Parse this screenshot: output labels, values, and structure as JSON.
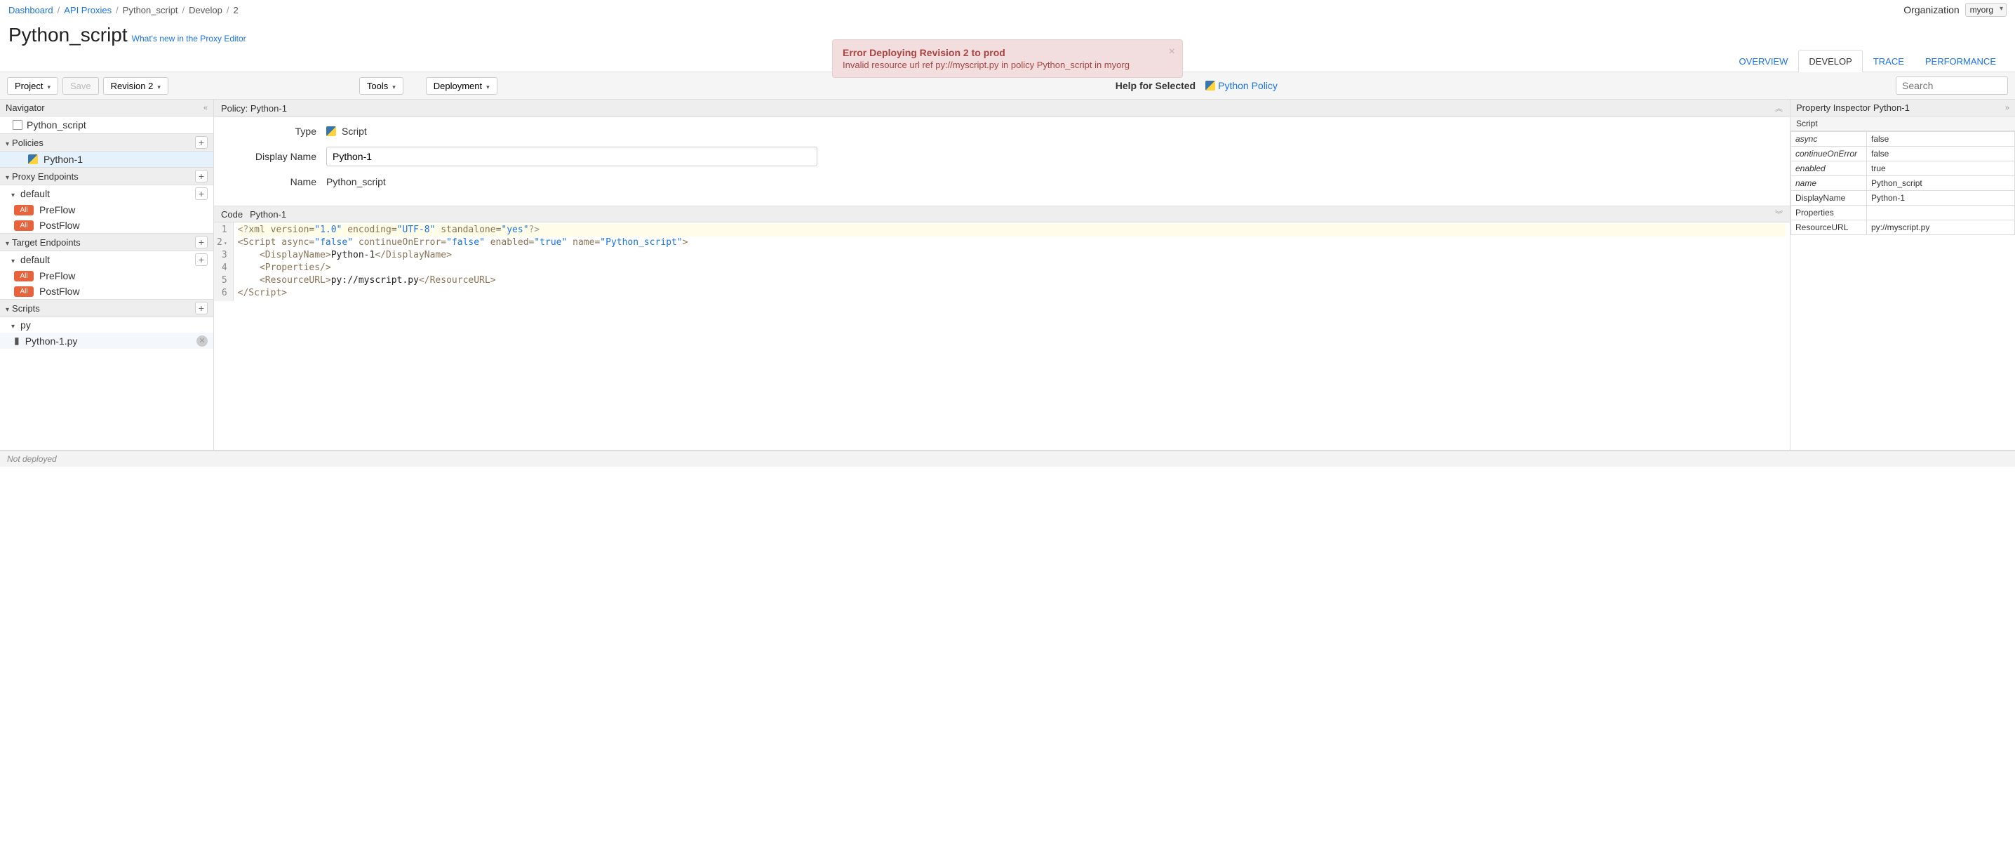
{
  "breadcrumb": {
    "dashboard": "Dashboard",
    "proxies": "API Proxies",
    "name": "Python_script",
    "develop": "Develop",
    "rev": "2"
  },
  "organization": {
    "label": "Organization",
    "value": "myorg"
  },
  "title": "Python_script",
  "whatsnew": "What's new in the Proxy Editor",
  "alert": {
    "title": "Error Deploying Revision 2 to prod",
    "message": "Invalid resource url ref py://myscript.py in policy Python_script in myorg"
  },
  "tabs": {
    "overview": "OVERVIEW",
    "develop": "DEVELOP",
    "trace": "TRACE",
    "performance": "PERFORMANCE"
  },
  "toolbar": {
    "project": "Project",
    "save": "Save",
    "revision": "Revision 2",
    "tools": "Tools",
    "deployment": "Deployment",
    "help_label": "Help for Selected",
    "help_link": "Python Policy",
    "search_placeholder": "Search"
  },
  "navigator": {
    "title": "Navigator",
    "root": "Python_script",
    "policies": "Policies",
    "policy1": "Python-1",
    "proxy_endpoints": "Proxy Endpoints",
    "default": "default",
    "preflow": "PreFlow",
    "postflow": "PostFlow",
    "target_endpoints": "Target Endpoints",
    "scripts": "Scripts",
    "py": "py",
    "script_file": "Python-1.py",
    "all": "All"
  },
  "policy": {
    "header": "Policy: Python-1",
    "type_label": "Type",
    "type_value": "Script",
    "display_name_label": "Display Name",
    "display_name_value": "Python-1",
    "name_label": "Name",
    "name_value": "Python_script"
  },
  "code": {
    "label": "Code",
    "name": "Python-1",
    "lines": [
      "1",
      "2",
      "3",
      "4",
      "5",
      "6"
    ]
  },
  "inspector": {
    "header": "Property Inspector  Python-1",
    "section": "Script",
    "rows": [
      {
        "k": "async",
        "v": "false",
        "ital": true
      },
      {
        "k": "continueOnError",
        "v": "false",
        "ital": true
      },
      {
        "k": "enabled",
        "v": "true",
        "ital": true
      },
      {
        "k": "name",
        "v": "Python_script",
        "ital": true
      },
      {
        "k": "DisplayName",
        "v": "Python-1",
        "ital": false
      },
      {
        "k": "Properties",
        "v": "",
        "ital": false
      },
      {
        "k": "ResourceURL",
        "v": "py://myscript.py",
        "ital": false
      }
    ]
  },
  "status": "Not deployed"
}
